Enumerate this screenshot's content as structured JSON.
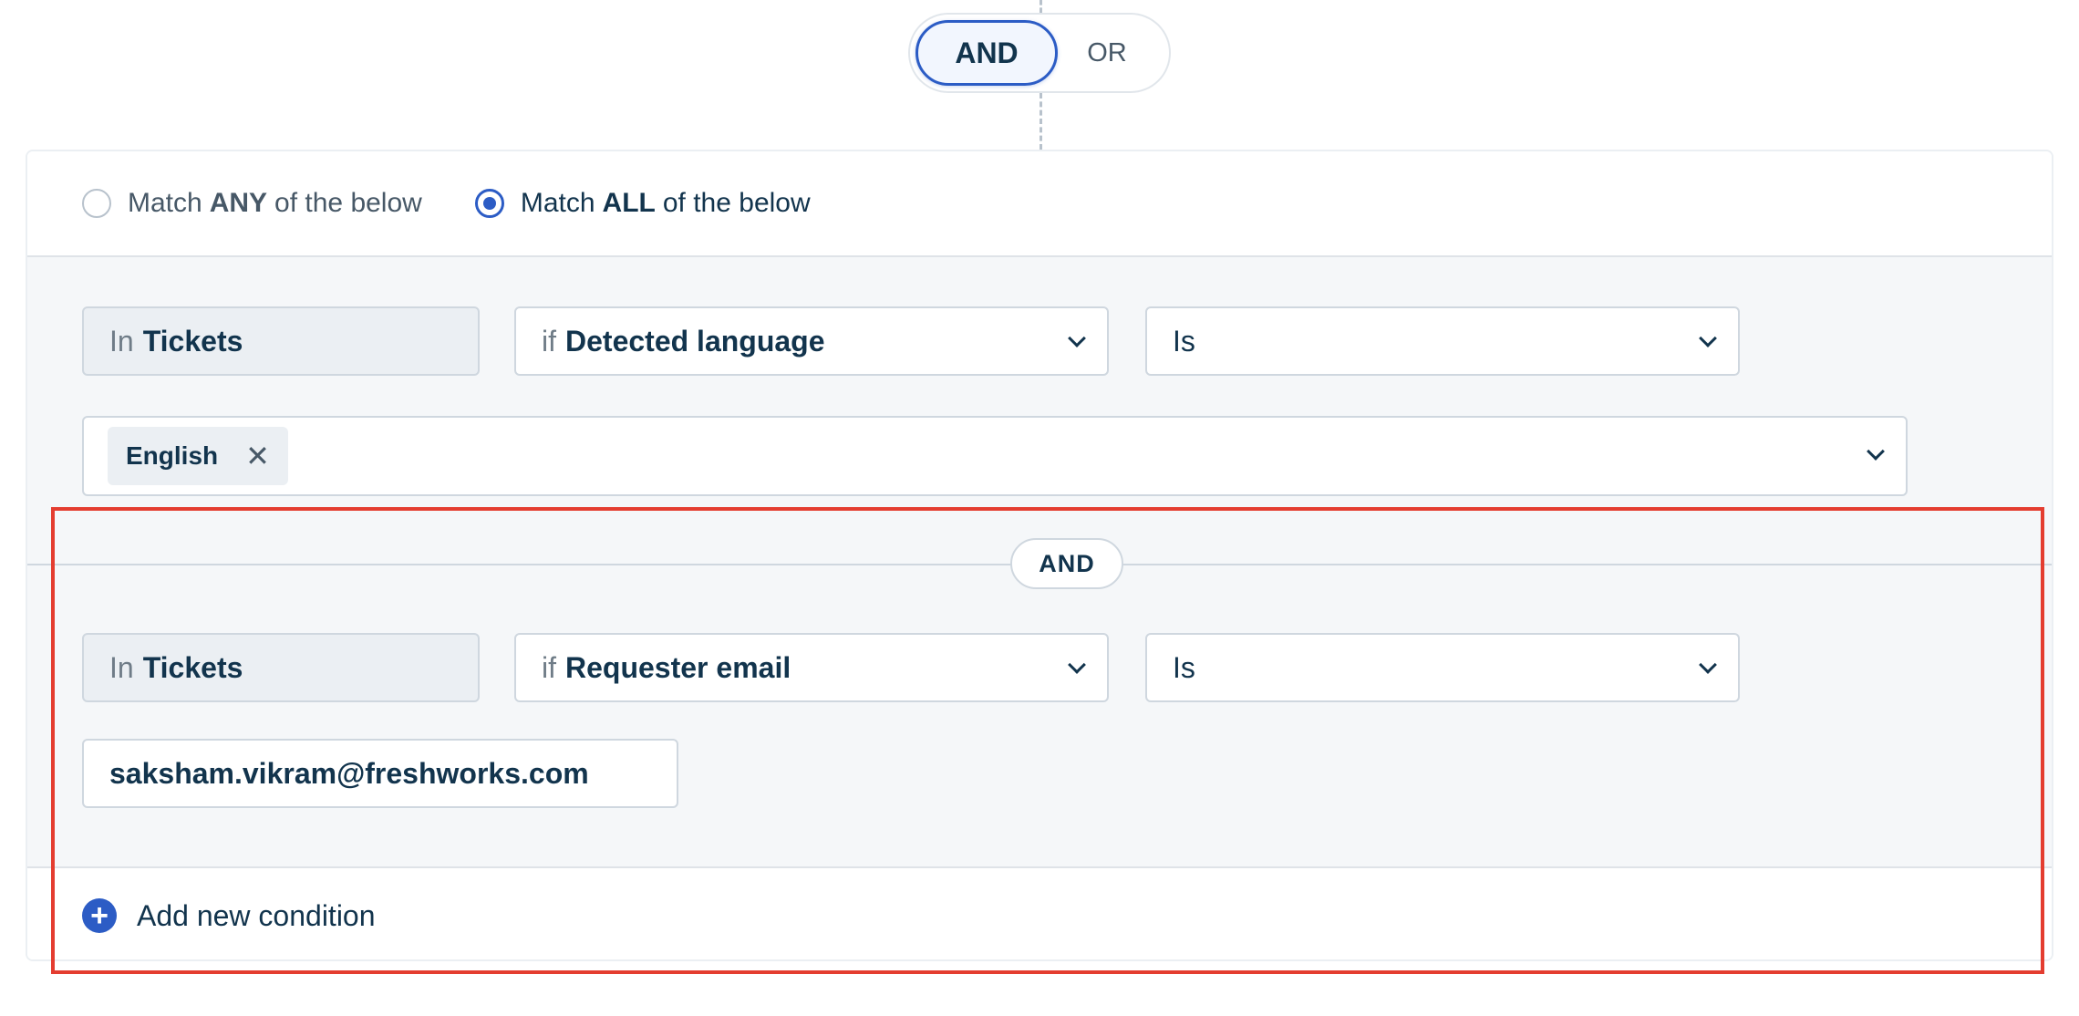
{
  "operator_toggle": {
    "and_label": "AND",
    "or_label": "OR",
    "selected": "AND"
  },
  "match": {
    "any": {
      "prefix": "Match",
      "keyword": "ANY",
      "suffix": "of the below",
      "selected": false
    },
    "all": {
      "prefix": "Match",
      "keyword": "ALL",
      "suffix": "of the below",
      "selected": true
    }
  },
  "conditions": [
    {
      "module_prefix": "In",
      "module": "Tickets",
      "field_prefix": "if",
      "field": "Detected language",
      "operator": "Is",
      "values": [
        "English"
      ]
    },
    {
      "module_prefix": "In",
      "module": "Tickets",
      "field_prefix": "if",
      "field": "Requester email",
      "operator": "Is",
      "value": "saksham.vikram@freshworks.com"
    }
  ],
  "joiner_label": "AND",
  "add_condition_label": "Add new condition",
  "icons": {
    "remove_tag": "close-icon",
    "add": "plus-circle-icon",
    "dropdown": "chevron-down-icon"
  },
  "colors": {
    "primary": "#2c5cc5",
    "highlight": "#e43d30",
    "text": "#12344d"
  }
}
